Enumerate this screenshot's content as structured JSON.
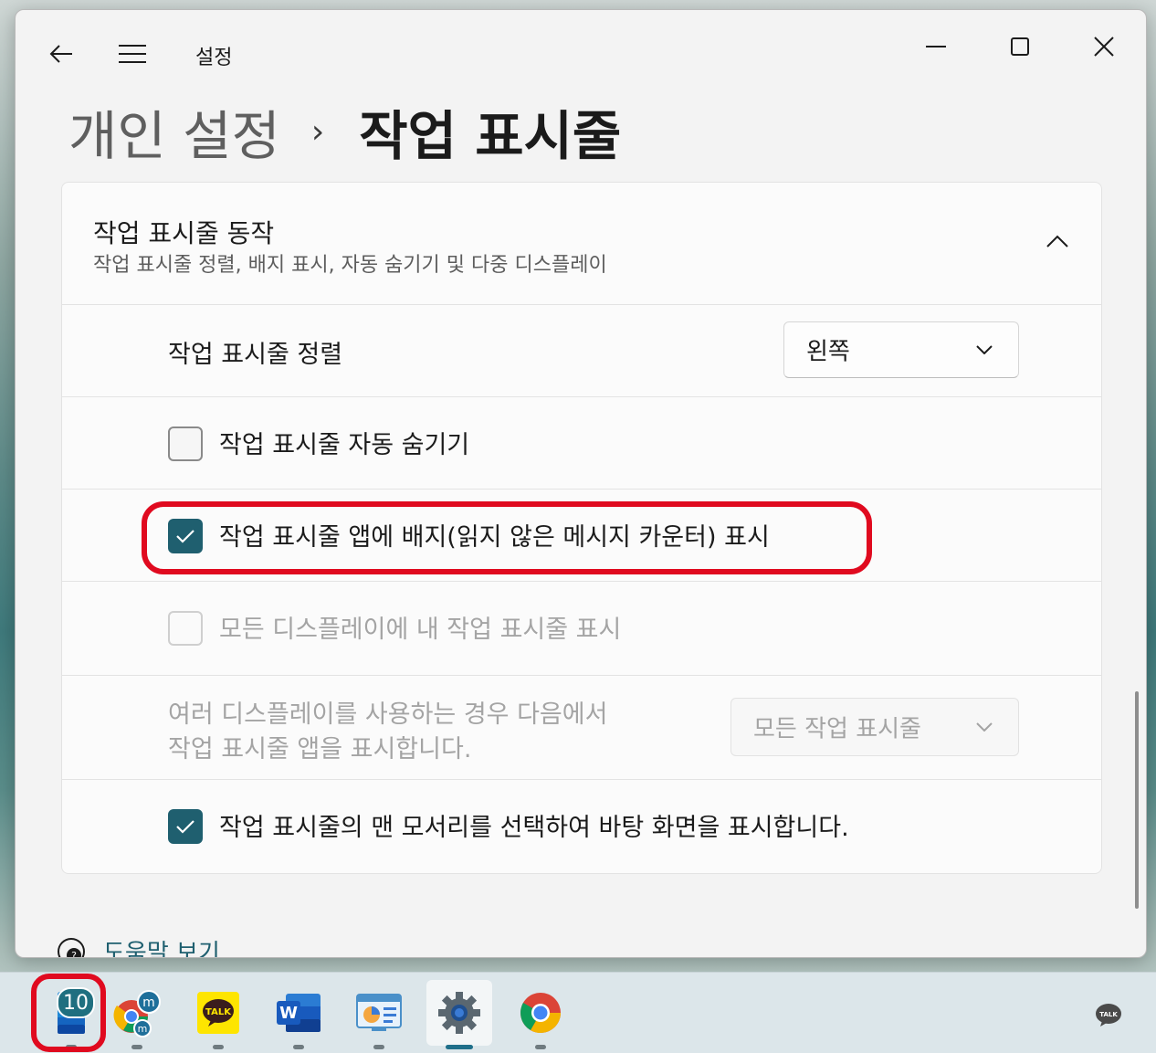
{
  "window": {
    "app_title": "설정",
    "breadcrumb": {
      "parent": "개인 설정",
      "separator": "›",
      "current": "작업 표시줄"
    }
  },
  "section": {
    "title": "작업 표시줄 동작",
    "subtitle": "작업 표시줄 정렬, 배지 표시, 자동 숨기기 및 다중 디스플레이",
    "expanded": true
  },
  "settings": {
    "alignment": {
      "label": "작업 표시줄 정렬",
      "value": "왼쪽"
    },
    "auto_hide": {
      "label": "작업 표시줄 자동 숨기기",
      "checked": false
    },
    "badges": {
      "label": "작업 표시줄 앱에 배지(읽지 않은 메시지 카운터) 표시",
      "checked": true
    },
    "all_displays": {
      "label": "모든 디스플레이에 내 작업 표시줄 표시",
      "checked": false,
      "disabled": true
    },
    "multi_display": {
      "label_line1": "여러 디스플레이를 사용하는 경우 다음에서",
      "label_line2": "작업 표시줄 앱을 표시합니다.",
      "value": "모든 작업 표시줄",
      "disabled": true
    },
    "corner_desktop": {
      "label": "작업 표시줄의 맨 모서리를 선택하여 바탕 화면을 표시합니다.",
      "checked": true
    }
  },
  "help": {
    "label": "도움말 보기"
  },
  "taskbar": {
    "apps": [
      {
        "name": "calendar-app",
        "badge": "10"
      },
      {
        "name": "chrome-messenger-app"
      },
      {
        "name": "kakaotalk-app",
        "icon_text": "TALK"
      },
      {
        "name": "word-app",
        "icon_text": "W"
      },
      {
        "name": "control-panel-app"
      },
      {
        "name": "settings-app",
        "active": true
      },
      {
        "name": "chrome-app"
      }
    ],
    "tray_icon_text": "TALK"
  },
  "colors": {
    "accent": "#1f5f6f",
    "highlight": "#e00a1f"
  }
}
